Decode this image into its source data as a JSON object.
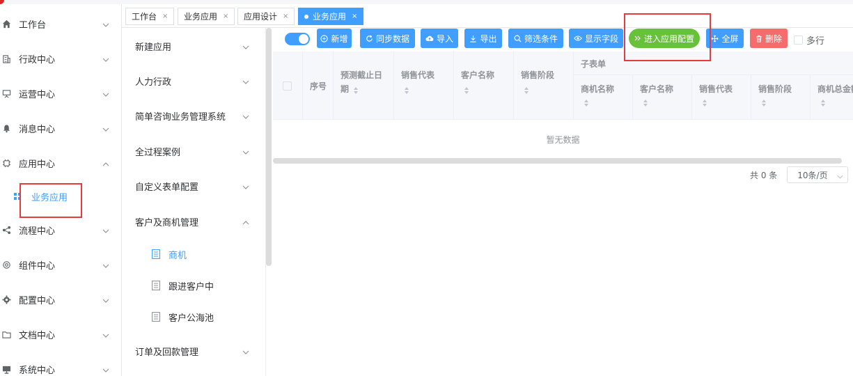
{
  "tabs": [
    {
      "label": "工作台",
      "close": "×"
    },
    {
      "label": "业务应用",
      "close": "×"
    },
    {
      "label": "应用设计",
      "close": "×"
    },
    {
      "label": "业务应用",
      "close": "×",
      "active": true
    }
  ],
  "nav": {
    "items": [
      {
        "label": "工作台",
        "icon": "home-icon"
      },
      {
        "label": "行政中心",
        "icon": "building-icon"
      },
      {
        "label": "运营中心",
        "icon": "presentation-icon"
      },
      {
        "label": "消息中心",
        "icon": "bell-icon"
      },
      {
        "label": "应用中心",
        "icon": "chip-icon",
        "expanded": true
      },
      {
        "label": "流程中心",
        "icon": "share-icon"
      },
      {
        "label": "组件中心",
        "icon": "gear-icon"
      },
      {
        "label": "配置中心",
        "icon": "cog-icon"
      },
      {
        "label": "文档中心",
        "icon": "folder-icon"
      },
      {
        "label": "系统中心",
        "icon": "monitor-icon"
      }
    ],
    "sub_active": "业务应用"
  },
  "categories": {
    "items": [
      {
        "label": "新建应用"
      },
      {
        "label": "人力行政"
      },
      {
        "label": "简单咨询业务管理系统"
      },
      {
        "label": "全过程案例"
      },
      {
        "label": "自定义表单配置"
      },
      {
        "label": "客户及商机管理",
        "expanded": true
      },
      {
        "label": "订单及回款管理"
      }
    ],
    "sub": [
      {
        "label": "商机",
        "active": true
      },
      {
        "label": "跟进客户中"
      },
      {
        "label": "客户公海池"
      }
    ]
  },
  "toolbar": {
    "add": "新增",
    "sync": "同步数据",
    "import": "导入",
    "export": "导出",
    "filter": "筛选条件",
    "show_fields": "显示字段",
    "enter_config": "进入应用配置",
    "fullscreen": "全屏",
    "delete": "删除",
    "multiline": "多行"
  },
  "table": {
    "columns": [
      "序号",
      "预测截止日期",
      "销售代表",
      "客户名称",
      "销售阶段"
    ],
    "subtable_group": "子表单",
    "sub_columns": [
      "商机名称",
      "客户名称",
      "销售代表",
      "销售阶段",
      "商机总金额"
    ],
    "empty_text": "暂无数据"
  },
  "pagination": {
    "total": "共 0 条",
    "page_size": "10条/页"
  },
  "colors": {
    "primary": "#409eff",
    "success": "#67c23a",
    "danger": "#f56c6c",
    "highlight": "#e8393b"
  }
}
